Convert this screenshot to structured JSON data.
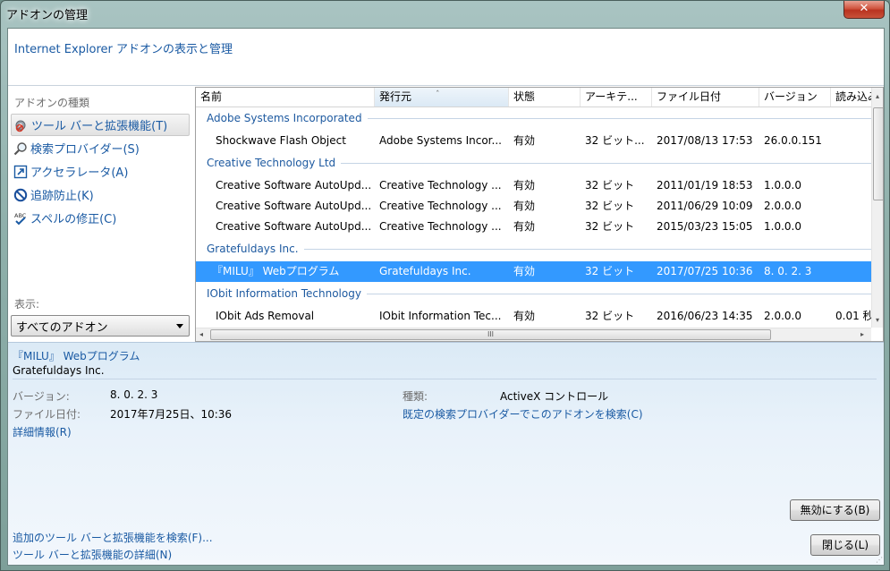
{
  "window": {
    "title": "アドオンの管理",
    "close_glyph": "✕"
  },
  "header": {
    "text": "Internet Explorer アドオンの表示と管理"
  },
  "sidebar": {
    "types_label": "アドオンの種類",
    "items": [
      {
        "label": "ツール バーと拡張機能(T)",
        "icon": "gear-puzzle-icon",
        "selected": true
      },
      {
        "label": "検索プロバイダー(S)",
        "icon": "magnifier-icon",
        "selected": false
      },
      {
        "label": "アクセラレータ(A)",
        "icon": "accelerator-icon",
        "selected": false
      },
      {
        "label": "追跡防止(K)",
        "icon": "no-entry-icon",
        "selected": false
      },
      {
        "label": "スペルの修正(C)",
        "icon": "spell-check-icon",
        "selected": false
      }
    ],
    "show_label": "表示:",
    "show_value": "すべてのアドオン"
  },
  "list": {
    "columns": [
      "名前",
      "発行元",
      "状態",
      "アーキテ...",
      "ファイル日付",
      "バージョン",
      "読み込み"
    ],
    "sorted_column": "発行元",
    "sort_glyph": "ˆ",
    "groups": [
      {
        "name": "Adobe Systems Incorporated",
        "rows": [
          {
            "name": "Shockwave Flash Object",
            "publisher": "Adobe Systems Incor...",
            "status": "有効",
            "arch": "32 ビット...",
            "date": "2017/08/13 17:53",
            "version": "26.0.0.151",
            "load": ""
          }
        ]
      },
      {
        "name": "Creative Technology Ltd",
        "rows": [
          {
            "name": "Creative Software AutoUpd...",
            "publisher": "Creative Technology ...",
            "status": "有効",
            "arch": "32 ビット",
            "date": "2011/01/19 18:53",
            "version": "1.0.0.0",
            "load": ""
          },
          {
            "name": "Creative Software AutoUpd...",
            "publisher": "Creative Technology ...",
            "status": "有効",
            "arch": "32 ビット",
            "date": "2011/06/29 10:09",
            "version": "2.0.0.0",
            "load": ""
          },
          {
            "name": "Creative Software AutoUpd...",
            "publisher": "Creative Technology ...",
            "status": "有効",
            "arch": "32 ビット",
            "date": "2015/03/23 15:05",
            "version": "1.0.0.0",
            "load": ""
          }
        ]
      },
      {
        "name": "Gratefuldays Inc.",
        "rows": [
          {
            "name": "『MILU』 Webプログラム",
            "publisher": "Gratefuldays Inc.",
            "status": "有効",
            "arch": "32 ビット",
            "date": "2017/07/25 10:36",
            "version": "8. 0. 2. 3",
            "load": "",
            "selected": true
          }
        ]
      },
      {
        "name": "IObit Information Technology",
        "rows": [
          {
            "name": "IObit Ads Removal",
            "publisher": "IObit Information Tec...",
            "status": "有効",
            "arch": "32 ビット",
            "date": "2016/06/23 14:35",
            "version": "2.0.0.0",
            "load": "0.01 秒"
          }
        ]
      }
    ],
    "hscroll_grip": "III",
    "scroll_left": "◂",
    "scroll_right": "▸",
    "scroll_up": "▴",
    "scroll_down": "▾"
  },
  "details": {
    "name": "『MILU』 Webプログラム",
    "publisher": "Gratefuldays Inc.",
    "version_label": "バージョン:",
    "version_value": "8. 0. 2. 3",
    "date_label": "ファイル日付:",
    "date_value": "2017年7月25日、10:36",
    "more_info": "詳細情報(R)",
    "type_label": "種類:",
    "type_value": "ActiveX コントロール",
    "search_link": "既定の検索プロバイダーでこのアドオンを検索(C)",
    "disable_button": "無効にする(B)",
    "find_more": "追加のツール バーと拡張機能を検索(F)...",
    "learn_more": "ツール バーと拡張機能の詳細(N)",
    "close_button": "閉じる(L)"
  },
  "colors": {
    "link": "#1a5aa3",
    "selection": "#3399ff",
    "group_header": "#1e5aa0"
  }
}
